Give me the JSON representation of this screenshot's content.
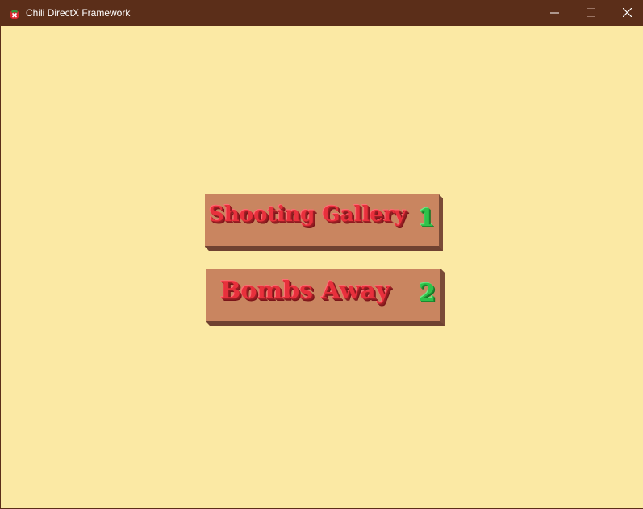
{
  "window": {
    "title": "Chili DirectX Framework",
    "icon": "chili-app-icon",
    "controls": {
      "minimize_icon": "minimize-icon",
      "maximize_icon": "maximize-icon",
      "close_icon": "close-icon"
    }
  },
  "colors": {
    "titlebar": "#5b2e19",
    "background": "#fbe9a4",
    "block_face": "#c98560",
    "block_side": "#8d5a42",
    "label_text": "#e8303c",
    "number_text": "#2fc24a"
  },
  "menu": {
    "options": [
      {
        "label": "Shooting Gallery",
        "number": "1"
      },
      {
        "label": "Bombs Away",
        "number": "2"
      }
    ]
  }
}
